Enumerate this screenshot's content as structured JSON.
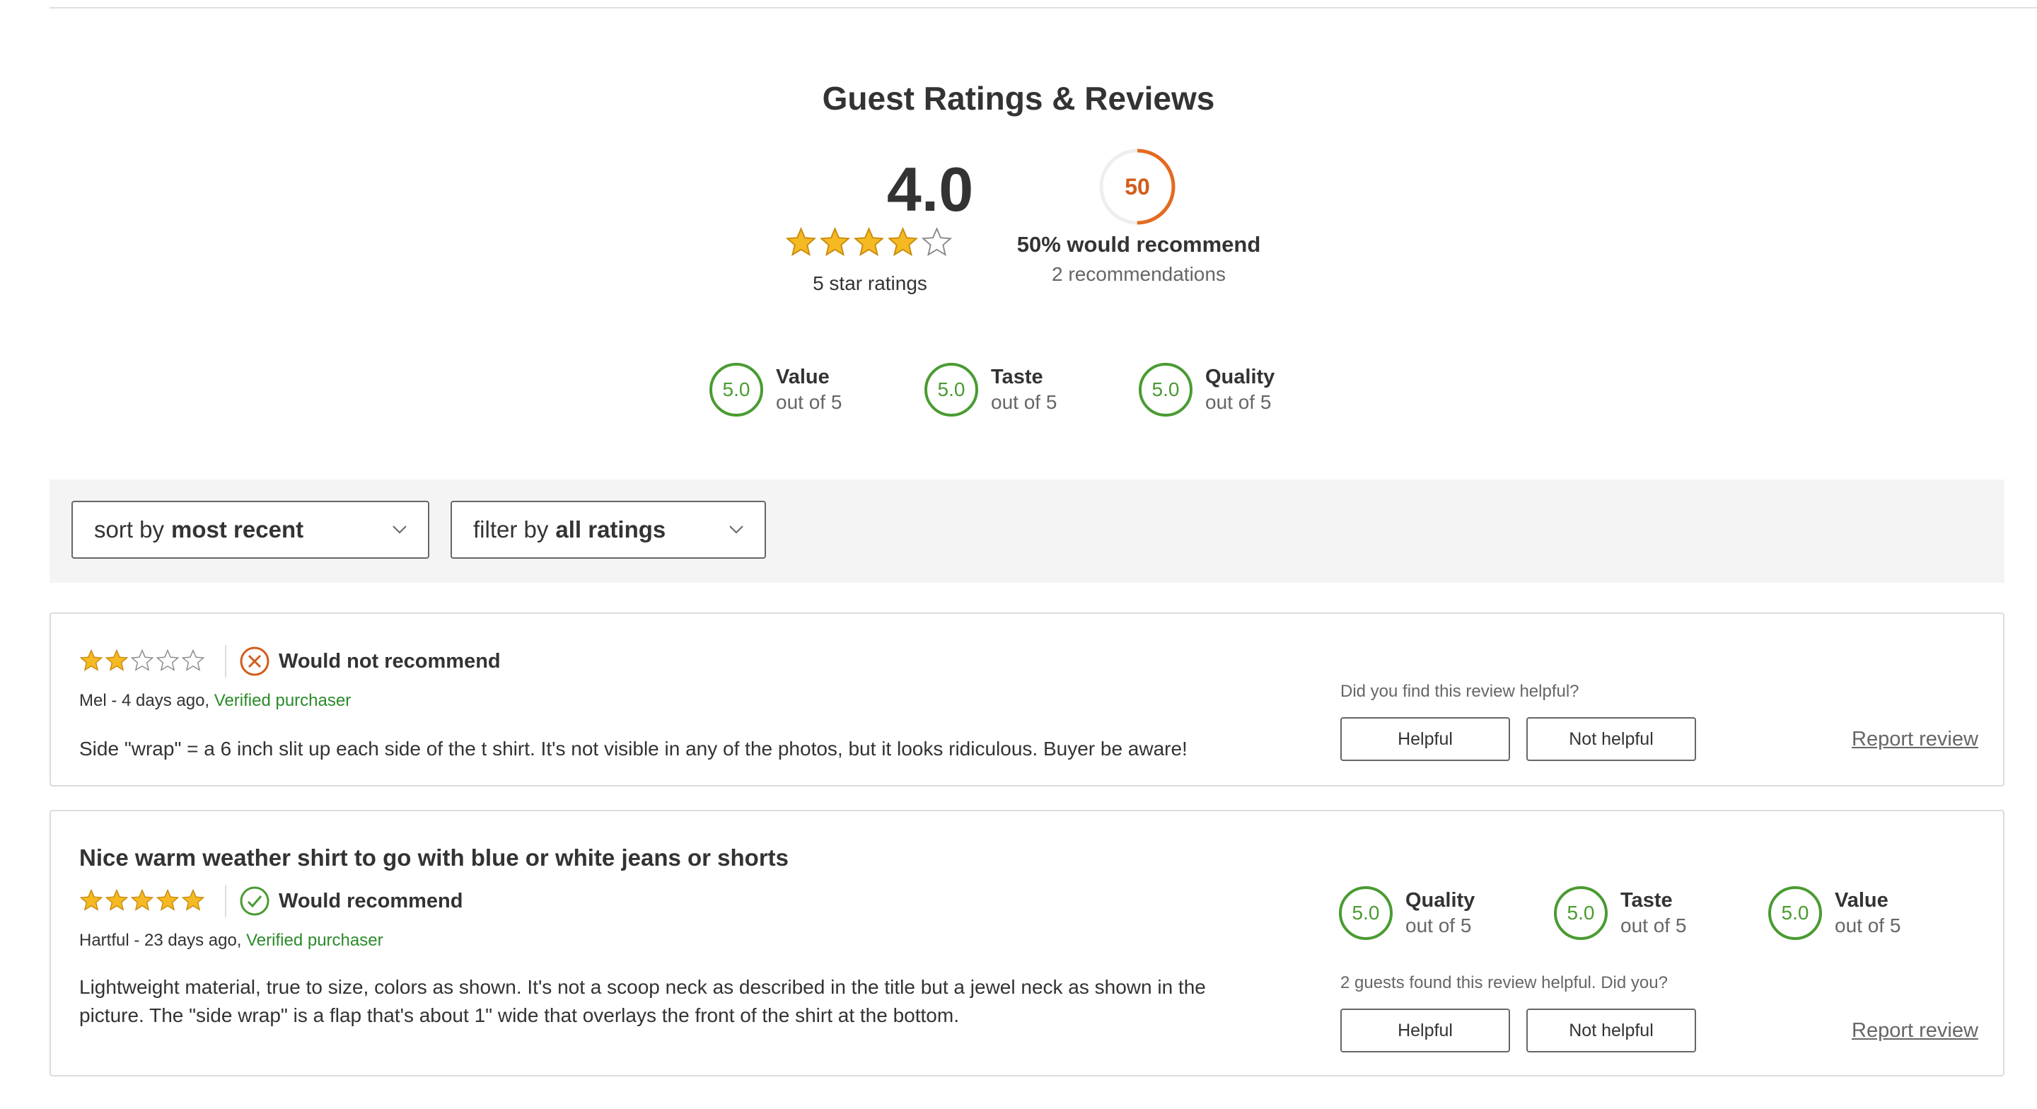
{
  "heading": "Guest Ratings & Reviews",
  "summary": {
    "average": "4.0",
    "average_stars": 4,
    "ratings_count_text": "5 star ratings",
    "recommend_percent": 50,
    "recommend_ring_text": "50",
    "recommend_text": "50% would recommend",
    "recommend_count_text": "2 recommendations",
    "attributes": [
      {
        "score": "5.0",
        "label": "Value",
        "sub": "out of 5"
      },
      {
        "score": "5.0",
        "label": "Taste",
        "sub": "out of 5"
      },
      {
        "score": "5.0",
        "label": "Quality",
        "sub": "out of 5"
      }
    ]
  },
  "toolbar": {
    "sort_prefix": "sort by",
    "sort_value": "most recent",
    "filter_prefix": "filter by",
    "filter_value": "all ratings"
  },
  "reviews": [
    {
      "title": "",
      "rating": 2,
      "recommend_text": "Would not recommend",
      "author_date": "Mel - 4 days ago, ",
      "verified": "Verified purchaser",
      "body": "Side \"wrap\" = a 6 inch slit up each side of the t shirt. It's not visible in any of the photos, but it looks ridiculous. Buyer be aware!",
      "helpful_question": "Did you find this review helpful?",
      "helpful_label": "Helpful",
      "not_helpful_label": "Not helpful",
      "report_label": "Report review"
    },
    {
      "title": "Nice warm weather shirt to go with blue or white jeans or shorts",
      "rating": 5,
      "recommend_text": "Would recommend",
      "author_date": "Hartful - 23 days ago, ",
      "verified": "Verified purchaser",
      "body": "Lightweight material, true to size, colors as shown. It's not a scoop neck as described in the title but a jewel neck as shown in the picture. The \"side wrap\" is a flap that's about 1\" wide that overlays the front of the shirt at the bottom.",
      "attributes": [
        {
          "score": "5.0",
          "label": "Quality",
          "sub": "out of 5"
        },
        {
          "score": "5.0",
          "label": "Taste",
          "sub": "out of 5"
        },
        {
          "score": "5.0",
          "label": "Value",
          "sub": "out of 5"
        }
      ],
      "helpful_question": "2 guests found this review helpful. Did you?",
      "helpful_label": "Helpful",
      "not_helpful_label": "Not helpful",
      "report_label": "Report review"
    }
  ],
  "colors": {
    "star_fill": "#f5b923",
    "star_outline": "#888888",
    "score_green": "#4a9b32",
    "recommend_orange": "#d25c1b",
    "verified_green": "#2a8a2a",
    "toolbar_bg": "#f4f4f4"
  }
}
